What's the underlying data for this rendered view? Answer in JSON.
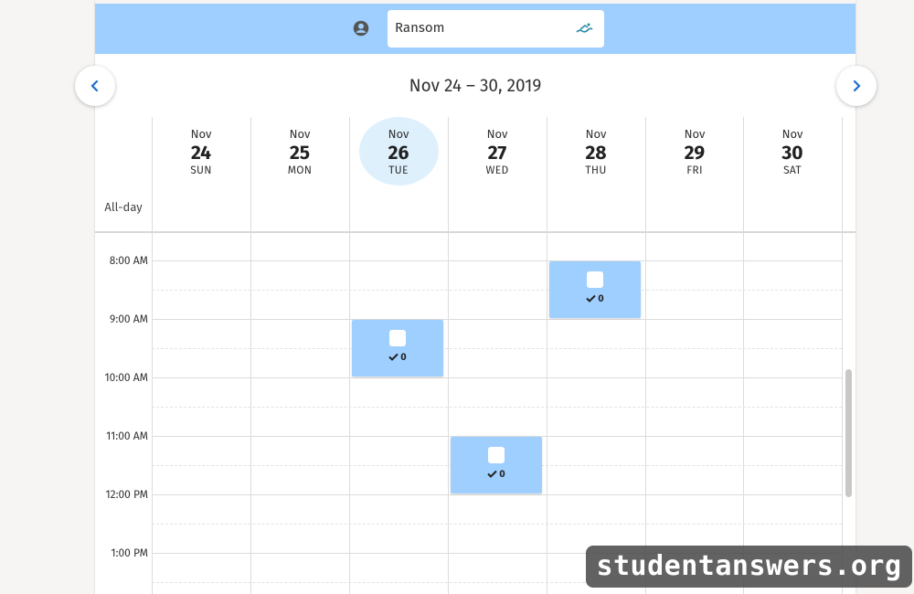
{
  "header": {
    "user_name": "Ransom",
    "user_icon": "account-circle-icon",
    "filter_icon": "swimmer-icon",
    "accent_color": "#9fcfff"
  },
  "navigation": {
    "date_range": "Nov 24 – 30, 2019",
    "prev_icon": "chevron-left-icon",
    "next_icon": "chevron-right-icon"
  },
  "days": [
    {
      "month": "Nov",
      "day": "24",
      "weekday": "SUN"
    },
    {
      "month": "Nov",
      "day": "25",
      "weekday": "MON"
    },
    {
      "month": "Nov",
      "day": "26",
      "weekday": "TUE",
      "today": true
    },
    {
      "month": "Nov",
      "day": "27",
      "weekday": "WED"
    },
    {
      "month": "Nov",
      "day": "28",
      "weekday": "THU"
    },
    {
      "month": "Nov",
      "day": "29",
      "weekday": "FRI"
    },
    {
      "month": "Nov",
      "day": "30",
      "weekday": "SAT"
    }
  ],
  "allday_label": "All-day",
  "time_slots": [
    "8:00 AM",
    "9:00 AM",
    "10:00 AM",
    "11:00 AM",
    "12:00 PM",
    "1:00 PM"
  ],
  "events": [
    {
      "day": "TUE",
      "start": "9:00 AM",
      "end": "10:00 AM",
      "count": "0"
    },
    {
      "day": "WED",
      "start": "11:00 AM",
      "end": "12:00 PM",
      "count": "0"
    },
    {
      "day": "THU",
      "start": "8:00 AM",
      "end": "9:00 AM",
      "count": "0"
    }
  ],
  "watermark": "studentanswers.org"
}
